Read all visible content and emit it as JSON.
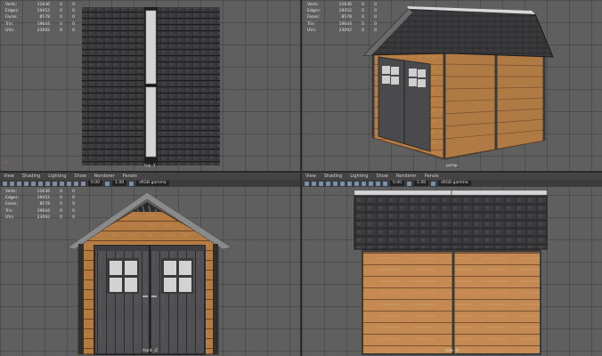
{
  "stats": {
    "rows": [
      {
        "label": "Verts:",
        "value": "11636",
        "z1": "0",
        "z2": "0"
      },
      {
        "label": "Edges:",
        "value": "19452",
        "z1": "0",
        "z2": "0"
      },
      {
        "label": "Faces:",
        "value": "8578",
        "z1": "0",
        "z2": "0"
      },
      {
        "label": "Tris:",
        "value": "19644",
        "z1": "0",
        "z2": "0"
      },
      {
        "label": "UVs:",
        "value": "23092",
        "z1": "0",
        "z2": "0"
      }
    ]
  },
  "viewport_menu": [
    "View",
    "Shading",
    "Lighting",
    "Show",
    "Renderer",
    "Panels"
  ],
  "toolbar": {
    "field_a": "0.00",
    "field_b": "1.00",
    "gamma_label": "sRGB gamma"
  },
  "cameras": {
    "top": "top -Y",
    "persp": "persp",
    "front": "front -Z",
    "side": "side -X"
  },
  "colors": {
    "wood": "#b07a45",
    "wood_dark": "#6b4726",
    "roof": "#2c2c2e",
    "door": "#4a4a4c",
    "trim": "#8a8a8a",
    "window": "#cfcfcf"
  }
}
